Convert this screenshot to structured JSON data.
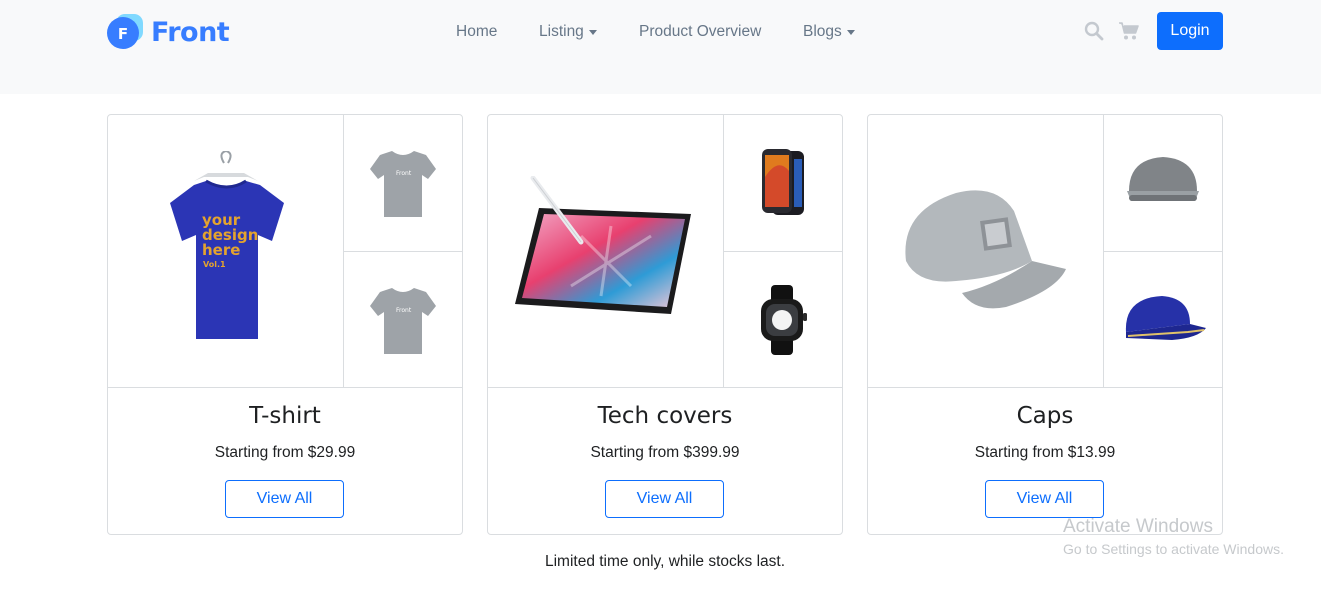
{
  "brand": {
    "letter": "F",
    "name": "Front"
  },
  "nav": {
    "items": [
      {
        "label": "Home",
        "dropdown": false
      },
      {
        "label": "Listing",
        "dropdown": true
      },
      {
        "label": "Product Overview",
        "dropdown": false
      },
      {
        "label": "Blogs",
        "dropdown": true
      }
    ],
    "icons": [
      "search-icon",
      "cart-icon"
    ],
    "login_label": "Login"
  },
  "products": [
    {
      "title": "T-shirt",
      "price": "Starting from $29.99",
      "button": "View All",
      "tee_print": [
        "your",
        "design",
        "here",
        "Vol.1"
      ],
      "mini_logo": "Front"
    },
    {
      "title": "Tech covers",
      "price": "Starting from $399.99",
      "button": "View All"
    },
    {
      "title": "Caps",
      "price": "Starting from $13.99",
      "button": "View All"
    }
  ],
  "footer_note": "Limited time only, while stocks last.",
  "watermark": {
    "title": "Activate Windows",
    "subtitle": "Go to Settings to activate Windows."
  },
  "colors": {
    "brand": "#377dff",
    "primary": "#0d6efd",
    "topbar": "#f8f9fa",
    "border": "#dadde0"
  }
}
